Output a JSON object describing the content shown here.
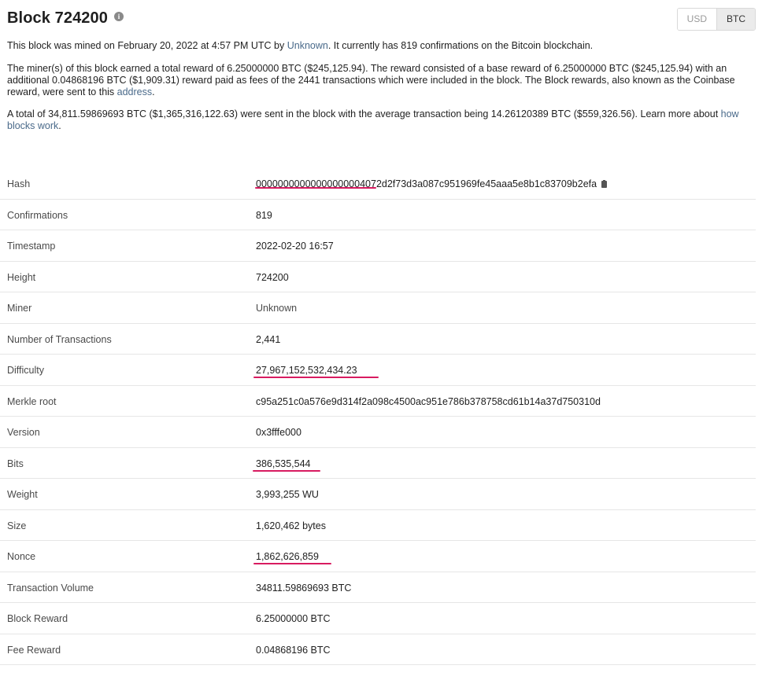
{
  "header": {
    "title": "Block 724200",
    "info_icon": "info-icon"
  },
  "currency": {
    "options": [
      "USD",
      "BTC"
    ],
    "selected": "BTC"
  },
  "summary": {
    "p1_a": "This block was mined on February 20, 2022 at 4:57 PM UTC by ",
    "p1_link": "Unknown",
    "p1_b": ". It currently has 819 confirmations on the Bitcoin blockchain.",
    "p2_a": "The miner(s) of this block earned a total reward of 6.25000000 BTC ($245,125.94). The reward consisted of a base reward of 6.25000000 BTC ($245,125.94) with an additional 0.04868196 BTC ($1,909.31) reward paid as fees of the 2441 transactions which were included in the block. The Block rewards, also known as the Coinbase reward, were sent to this ",
    "p2_link": "address",
    "p2_b": ".",
    "p3_a": "A total of 34,811.59869693 BTC ($1,365,316,122.63) were sent in the block with the average transaction being 14.26120389 BTC ($559,326.56).  Learn more about ",
    "p3_link": "how blocks work",
    "p3_b": "."
  },
  "details": [
    {
      "label": "Hash",
      "value": "00000000000000000004072d2f73d3a087c951969fe45aaa5e8b1c83709b2efa"
    },
    {
      "label": "Confirmations",
      "value": "819"
    },
    {
      "label": "Timestamp",
      "value": "2022-02-20 16:57"
    },
    {
      "label": "Height",
      "value": "724200"
    },
    {
      "label": "Miner",
      "value": "Unknown"
    },
    {
      "label": "Number of Transactions",
      "value": "2,441"
    },
    {
      "label": "Difficulty",
      "value": "27,967,152,532,434.23"
    },
    {
      "label": "Merkle root",
      "value": "c95a251c0a576e9d314f2a098c4500ac951e786b378758cd61b14a37d750310d"
    },
    {
      "label": "Version",
      "value": "0x3fffe000"
    },
    {
      "label": "Bits",
      "value": "386,535,544"
    },
    {
      "label": "Weight",
      "value": "3,993,255 WU"
    },
    {
      "label": "Size",
      "value": "1,620,462 bytes"
    },
    {
      "label": "Nonce",
      "value": "1,862,626,859"
    },
    {
      "label": "Transaction Volume",
      "value": "34811.59869693 BTC"
    },
    {
      "label": "Block Reward",
      "value": "6.25000000 BTC"
    },
    {
      "label": "Fee Reward",
      "value": "0.04868196 BTC"
    }
  ],
  "colors": {
    "highlight_underline": "#d81b60",
    "link": "#4a6a8a"
  }
}
